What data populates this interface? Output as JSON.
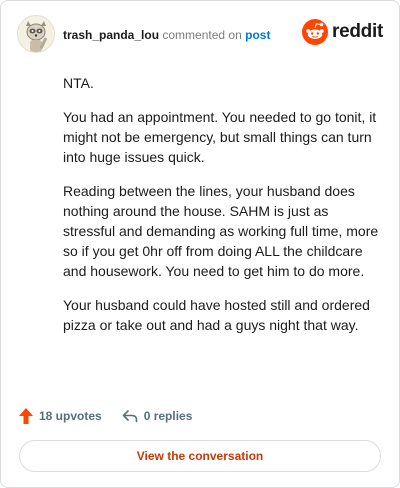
{
  "header": {
    "username": "trash_panda_lou",
    "action_text": "commented on",
    "post_link": "post",
    "brand": "reddit"
  },
  "comment": {
    "paragraphs": [
      "NTA.",
      "You had an appointment. You needed to go tonit, it might not be emergency, but small things can turn into huge issues quick.",
      "Reading between the lines, your husband does nothing around the house. SAHM is just as stressful and demanding as working full time, more so if you get 0hr off from doing ALL the childcare and housework. You need to get him to do more.",
      "Your husband could have hosted still and ordered pizza or take out and had a guys night that way."
    ]
  },
  "footer": {
    "upvotes": "18 upvotes",
    "replies": "0 replies"
  },
  "cta": {
    "label": "View the conversation"
  },
  "colors": {
    "reddit_orange": "#ff4500",
    "link_blue": "#0079d3",
    "cta_text": "#c23c06",
    "upvote_icon": "#ff4500",
    "muted": "#576f76"
  },
  "icons": [
    "avatar",
    "reddit-logo-icon",
    "upvote-arrow-icon",
    "reply-arrow-icon"
  ]
}
